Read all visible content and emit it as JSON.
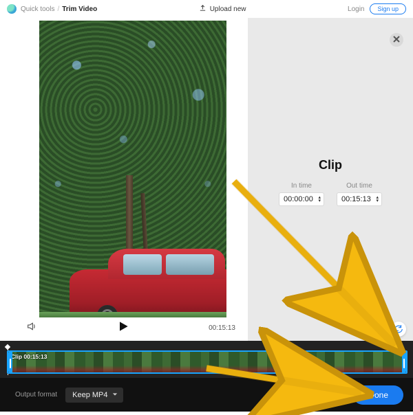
{
  "breadcrumb": {
    "parent": "Quick tools",
    "current": "Trim Video"
  },
  "header": {
    "upload": "Upload new",
    "login": "Login",
    "signup": "Sign up"
  },
  "transport": {
    "duration": "00:15:13"
  },
  "side": {
    "title": "Clip",
    "in_label": "In time",
    "out_label": "Out time",
    "in_value": "00:00:00",
    "out_value": "00:15:13"
  },
  "timeline": {
    "clip_label": "Clip 00:15:13"
  },
  "bottom": {
    "output_format_label": "Output format",
    "format_value": "Keep MP4",
    "done": "Done"
  }
}
